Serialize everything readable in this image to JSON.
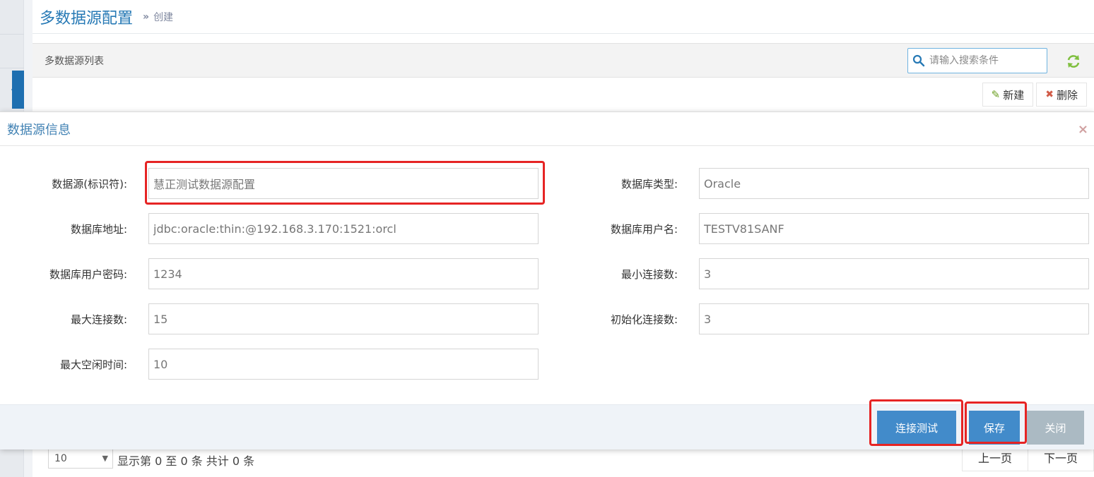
{
  "page": {
    "title": "多数据源配置",
    "breadcrumb_sep": "»",
    "breadcrumb_sub": "创建"
  },
  "list": {
    "title": "多数据源列表",
    "search_placeholder": "请输入搜索条件"
  },
  "toolbar": {
    "new_label": "新建",
    "delete_label": "删除"
  },
  "modal": {
    "title": "数据源信息",
    "close_symbol": "×",
    "fields": {
      "datasource": {
        "label": "数据源(标识符):",
        "value": "慧正测试数据源配置"
      },
      "db_type": {
        "label": "数据库类型:",
        "value": "Oracle"
      },
      "db_url": {
        "label": "数据库地址:",
        "value": "jdbc:oracle:thin:@192.168.3.170:1521:orcl"
      },
      "db_user": {
        "label": "数据库用户名:",
        "value": "TESTV81SANF"
      },
      "db_password": {
        "label": "数据库用户密码:",
        "value": "1234"
      },
      "min_conn": {
        "label": "最小连接数:",
        "value": "3"
      },
      "max_conn": {
        "label": "最大连接数:",
        "value": "15"
      },
      "init_conn": {
        "label": "初始化连接数:",
        "value": "3"
      },
      "max_idle": {
        "label": "最大空闲时间:",
        "value": "10"
      }
    },
    "buttons": {
      "test": "连接测试",
      "save": "保存",
      "close": "关闭"
    }
  },
  "pagination": {
    "page_size": "10",
    "info": "显示第 0 至 0 条 共计 0 条",
    "prev": "上一页",
    "next": "下一页"
  },
  "colors": {
    "primary": "#428bca",
    "highlight": "#e62424",
    "title_blue": "#2679b5"
  },
  "icons": {
    "search": "search-icon",
    "refresh": "refresh-icon",
    "edit": "pencil-icon",
    "delete": "x-icon",
    "sidebar_toggle": "chevron-left-icon"
  }
}
